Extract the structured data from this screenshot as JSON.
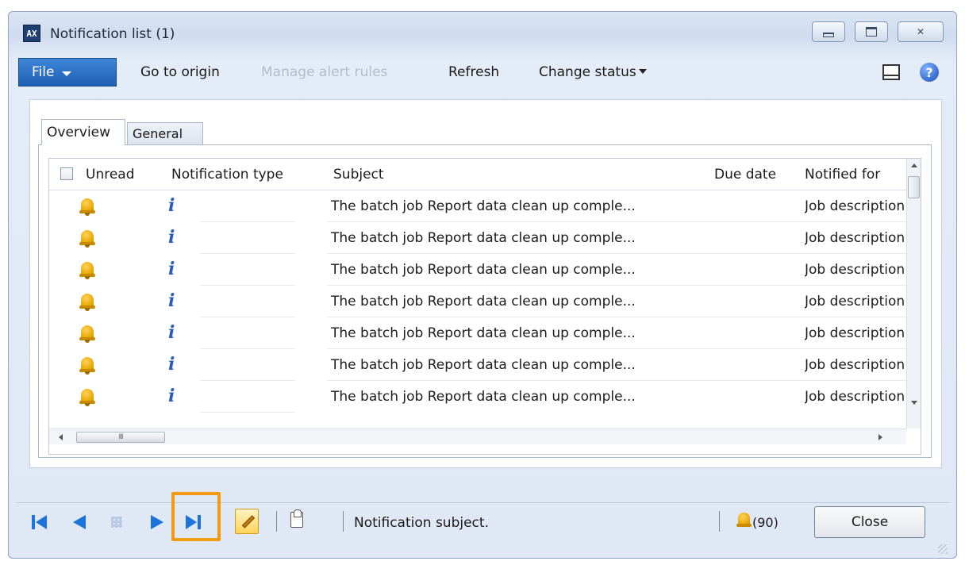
{
  "window": {
    "title": "Notification list (1)",
    "app_icon_text": "AX"
  },
  "action_pane": {
    "file_label": "File",
    "go_to_origin": "Go to origin",
    "manage_alert_rules": "Manage alert rules",
    "refresh": "Refresh",
    "change_status": "Change status",
    "help_glyph": "?"
  },
  "tabs": [
    {
      "label": "Overview",
      "active": true
    },
    {
      "label": "General",
      "active": false
    }
  ],
  "grid": {
    "columns": [
      "Unread",
      "Notification type",
      "Subject",
      "Due date",
      "Notified for"
    ],
    "rows": [
      {
        "subject": "The batch job Report data clean up comple...",
        "notified_for": "Job description"
      },
      {
        "subject": "The batch job Report data clean up comple...",
        "notified_for": "Job description"
      },
      {
        "subject": "The batch job Report data clean up comple...",
        "notified_for": "Job description"
      },
      {
        "subject": "The batch job Report data clean up comple...",
        "notified_for": "Job description"
      },
      {
        "subject": "The batch job Report data clean up comple...",
        "notified_for": "Job description"
      },
      {
        "subject": "The batch job Report data clean up comple...",
        "notified_for": "Job description"
      },
      {
        "subject": "The batch job Report data clean up comple...",
        "notified_for": "Job description"
      }
    ],
    "info_glyph": "i",
    "hscroll_thumb_glyph": "III"
  },
  "status_bar": {
    "message": "Notification subject.",
    "notification_count": "(90)",
    "close_label": "Close"
  },
  "colors": {
    "accent_blue": "#1c73d9",
    "highlight_orange": "#f39a14",
    "file_button": "#2a6fc4"
  }
}
